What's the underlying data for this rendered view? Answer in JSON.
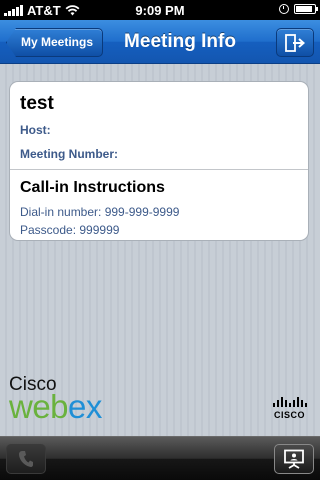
{
  "status_bar": {
    "carrier": "AT&T",
    "time": "9:09 PM",
    "icons": [
      "signal-bars-icon",
      "wifi-icon",
      "alarm-clock-icon",
      "battery-icon"
    ],
    "battery_level": 0.9
  },
  "nav": {
    "back_label": "My Meetings",
    "title": "Meeting Info",
    "right_icon": "leave-meeting-icon"
  },
  "meeting": {
    "title": "test",
    "host_label": "Host:",
    "host_value": "",
    "number_label": "Meeting Number:",
    "number_value": ""
  },
  "callin": {
    "heading": "Call-in Instructions",
    "dialin": "Dial-in number: 999-999-9999",
    "passcode": "Passcode: 999999"
  },
  "branding": {
    "cisco_word": "Cisco",
    "webex_part1": "web",
    "webex_part2": "ex",
    "cisco_small": "CISCO",
    "colors": {
      "webex_green": "#6ab23e",
      "webex_blue": "#1f8fd6",
      "nav_blue": "#1f6ecc",
      "label_blue": "#3d5a8a"
    }
  },
  "toolbar": {
    "left_icon": "phone-icon",
    "right_icon": "presenter-screen-icon"
  }
}
